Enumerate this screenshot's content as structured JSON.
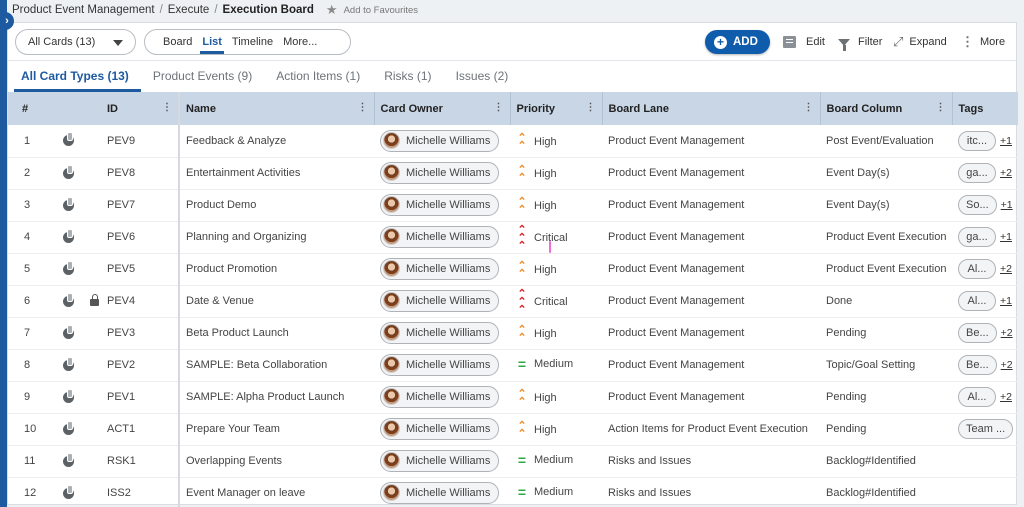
{
  "breadcrumb": {
    "items": [
      "Product Event Management",
      "Execute",
      "Execution Board"
    ],
    "separator": "/",
    "favourite_label": "Add to Favourites"
  },
  "toolbar": {
    "cards_select": "All Cards (13)",
    "views": [
      "Board",
      "List",
      "Timeline",
      "More..."
    ],
    "active_view": "List",
    "add_label": "ADD",
    "edit_label": "Edit",
    "filter_label": "Filter",
    "expand_label": "Expand",
    "more_label": "More"
  },
  "type_tabs": [
    {
      "label": "All Card Types (13)",
      "active": true
    },
    {
      "label": "Product Events (9)",
      "active": false
    },
    {
      "label": "Action Items (1)",
      "active": false
    },
    {
      "label": "Risks (1)",
      "active": false
    },
    {
      "label": "Issues (2)",
      "active": false
    }
  ],
  "table": {
    "columns": [
      "#",
      "ID",
      "Name",
      "Card Owner",
      "Priority",
      "Board Lane",
      "Board Column",
      "Tags"
    ],
    "rows": [
      {
        "num": "1",
        "locked": false,
        "id": "PEV9",
        "name": "Feedback & Analyze",
        "owner": "Michelle Williams",
        "priority": "High",
        "lane": "Product Event Management",
        "column": "Post Event/Evaluation",
        "tag": "itc...",
        "tag_more": "+1"
      },
      {
        "num": "2",
        "locked": false,
        "id": "PEV8",
        "name": "Entertainment Activities",
        "owner": "Michelle Williams",
        "priority": "High",
        "lane": "Product Event Management",
        "column": "Event Day(s)",
        "tag": "ga...",
        "tag_more": "+2"
      },
      {
        "num": "3",
        "locked": false,
        "id": "PEV7",
        "name": "Product Demo",
        "owner": "Michelle Williams",
        "priority": "High",
        "lane": "Product Event Management",
        "column": "Event Day(s)",
        "tag": "So...",
        "tag_more": "+1"
      },
      {
        "num": "4",
        "locked": false,
        "id": "PEV6",
        "name": "Planning and Organizing",
        "owner": "Michelle Williams",
        "priority": "Critical",
        "lane": "Product Event Management",
        "column": "Product Event Execution",
        "tag": "ga...",
        "tag_more": "+1"
      },
      {
        "num": "5",
        "locked": false,
        "id": "PEV5",
        "name": "Product Promotion",
        "owner": "Michelle Williams",
        "priority": "High",
        "lane": "Product Event Management",
        "column": "Product Event Execution",
        "tag": "Al...",
        "tag_more": "+2"
      },
      {
        "num": "6",
        "locked": true,
        "id": "PEV4",
        "name": "Date & Venue",
        "owner": "Michelle Williams",
        "priority": "Critical",
        "lane": "Product Event Management",
        "column": "Done",
        "tag": "Al...",
        "tag_more": "+1"
      },
      {
        "num": "7",
        "locked": false,
        "id": "PEV3",
        "name": "Beta Product Launch",
        "owner": "Michelle Williams",
        "priority": "High",
        "lane": "Product Event Management",
        "column": "Pending",
        "tag": "Be...",
        "tag_more": "+2"
      },
      {
        "num": "8",
        "locked": false,
        "id": "PEV2",
        "name": "SAMPLE: Beta Collaboration",
        "owner": "Michelle Williams",
        "priority": "Medium",
        "lane": "Product Event Management",
        "column": "Topic/Goal Setting",
        "tag": "Be...",
        "tag_more": "+2"
      },
      {
        "num": "9",
        "locked": false,
        "id": "PEV1",
        "name": "SAMPLE: Alpha Product Launch",
        "owner": "Michelle Williams",
        "priority": "High",
        "lane": "Product Event Management",
        "column": "Pending",
        "tag": "Al...",
        "tag_more": "+2"
      },
      {
        "num": "10",
        "locked": false,
        "id": "ACT1",
        "name": "Prepare Your Team",
        "owner": "Michelle Williams",
        "priority": "High",
        "lane": "Action Items for Product Event Execution",
        "column": "Pending",
        "tag": "Team ...",
        "tag_more": ""
      },
      {
        "num": "11",
        "locked": false,
        "id": "RSK1",
        "name": "Overlapping Events",
        "owner": "Michelle Williams",
        "priority": "Medium",
        "lane": "Risks and Issues",
        "column": "Backlog#Identified",
        "tag": "",
        "tag_more": ""
      },
      {
        "num": "12",
        "locked": false,
        "id": "ISS2",
        "name": "Event Manager on leave",
        "owner": "Michelle Williams",
        "priority": "Medium",
        "lane": "Risks and Issues",
        "column": "Backlog#Identified",
        "tag": "",
        "tag_more": ""
      }
    ]
  },
  "colors": {
    "brand": "#1e5aa0",
    "add_button": "#0f5cad",
    "header_bg": "#c8d6e6",
    "priority_high": "#f08a24",
    "priority_critical": "#d8232a",
    "priority_medium": "#2ea84a"
  }
}
